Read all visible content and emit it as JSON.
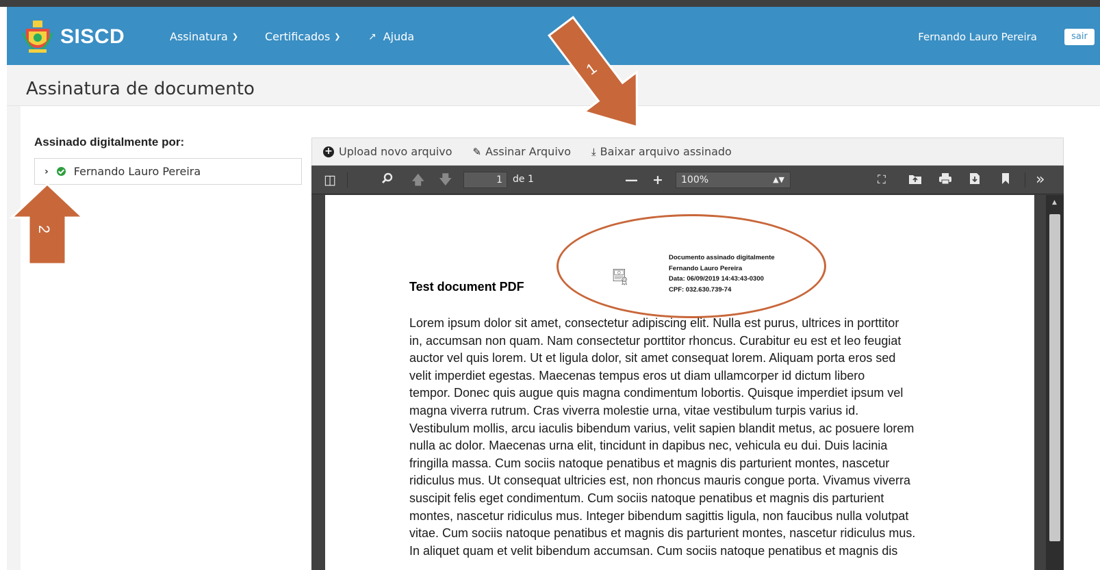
{
  "app": {
    "brand": "SISCD",
    "nav": [
      {
        "label": "Assinatura",
        "has_dropdown": true
      },
      {
        "label": "Certificados",
        "has_dropdown": true
      },
      {
        "label": "Ajuda",
        "has_dropdown": false
      }
    ],
    "user_name": "Fernando Lauro Pereira",
    "logout_label": "sair",
    "accent_color": "#3a8fc4"
  },
  "page": {
    "title": "Assinatura de documento"
  },
  "signers": {
    "label": "Assinado digitalmente por:",
    "items": [
      {
        "name": "Fernando Lauro Pereira",
        "status": "valid"
      }
    ]
  },
  "actions": {
    "upload_label": "Upload novo arquivo",
    "sign_label": "Assinar Arquivo",
    "download_label": "Baixar arquivo assinado"
  },
  "viewer": {
    "current_page": "1",
    "page_of": "de 1",
    "zoom": "100%",
    "icons": [
      "sidebar-toggle-icon",
      "search-icon",
      "previous-page-icon",
      "next-page-icon",
      "zoom-out-icon",
      "zoom-in-icon",
      "presentation-mode-icon",
      "open-file-icon",
      "print-icon",
      "download-icon",
      "bookmark-icon",
      "tools-icon"
    ]
  },
  "document": {
    "title": "Test document PDF",
    "stamp": {
      "line1": "Documento assinado digitalmente",
      "line2": "Fernando Lauro Pereira",
      "line3": "Data: 06/09/2019 14:43:43-0300",
      "line4": "CPF: 032.630.739-74"
    },
    "lines": [
      "Lorem ipsum dolor sit amet, consectetur adipiscing elit. Nulla est purus, ultrices in porttitor",
      "in, accumsan non quam. Nam consectetur porttitor rhoncus. Curabitur eu est et leo feugiat",
      "auctor vel quis lorem. Ut et ligula dolor, sit amet consequat lorem. Aliquam porta eros sed",
      "velit imperdiet egestas. Maecenas tempus eros ut diam ullamcorper id dictum libero",
      "tempor. Donec quis augue quis magna condimentum lobortis. Quisque imperdiet ipsum vel",
      "magna viverra rutrum. Cras viverra molestie urna, vitae vestibulum turpis varius id.",
      "Vestibulum mollis, arcu iaculis bibendum varius, velit sapien blandit metus, ac posuere lorem",
      "nulla ac dolor. Maecenas urna elit, tincidunt in dapibus nec, vehicula eu dui. Duis lacinia",
      "fringilla massa. Cum sociis natoque penatibus et magnis dis parturient montes, nascetur",
      "ridiculus mus. Ut consequat ultricies est, non rhoncus mauris congue porta. Vivamus viverra",
      "suscipit felis eget condimentum. Cum sociis natoque penatibus et magnis dis parturient",
      "montes, nascetur ridiculus mus. Integer bibendum sagittis ligula, non faucibus nulla volutpat",
      "vitae. Cum sociis natoque penatibus et magnis dis parturient montes, nascetur ridiculus mus.",
      "In aliquet quam et velit bibendum accumsan. Cum sociis natoque penatibus et magnis dis"
    ]
  },
  "annotations": {
    "arrow1_label": "1",
    "arrow2_label": "2",
    "color": "#c8673a"
  }
}
